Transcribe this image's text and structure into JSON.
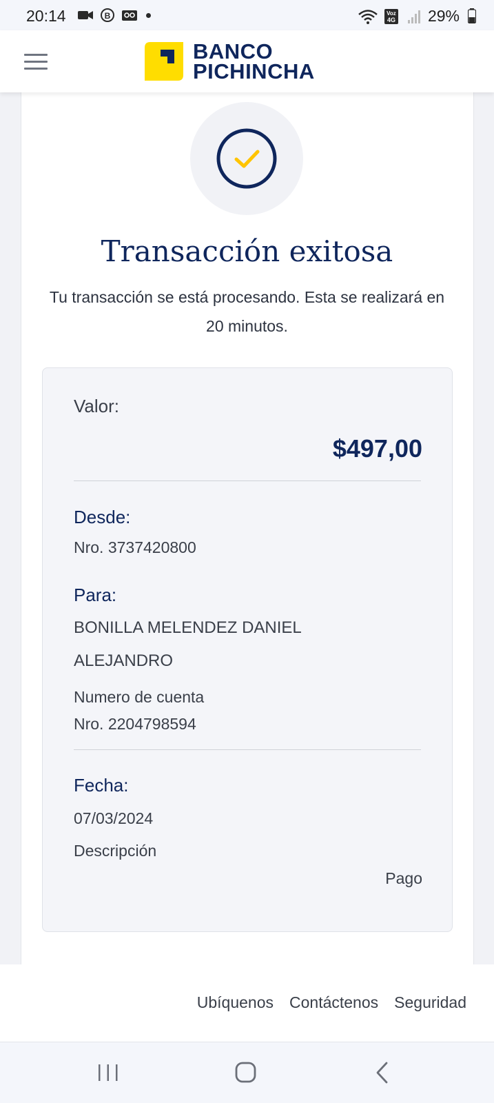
{
  "status_bar": {
    "time": "20:14",
    "battery": "29%",
    "network_badge": "Voz 4G",
    "icons_left": [
      "video-call-icon",
      "b-circle-icon",
      "voicemail-icon",
      "notification-dot-icon"
    ],
    "icons_right": [
      "wifi-icon",
      "volte-4g-icon",
      "signal-icon",
      "battery-icon"
    ]
  },
  "header": {
    "logo_line1": "BANCO",
    "logo_line2": "PICHINCHA",
    "menu_icon": "hamburger-menu-icon",
    "brand_yellow": "#FFDD00",
    "brand_navy": "#0F265C"
  },
  "result": {
    "icon": "check-circle-icon",
    "title": "Transacción exitosa",
    "subtitle": "Tu transacción se está procesando. Esta se realizará en 20 minutos."
  },
  "details": {
    "valor_label": "Valor:",
    "amount": "$497,00",
    "desde_label": "Desde:",
    "desde_value": "Nro. 3737420800",
    "para_label": "Para:",
    "para_name": "BONILLA MELENDEZ DANIEL ALEJANDRO",
    "para_account_label": "Numero de cuenta",
    "para_account": "Nro. 2204798594",
    "fecha_label": "Fecha:",
    "fecha_value": "07/03/2024",
    "descripcion_label": "Descripción",
    "descripcion_value": "Pago"
  },
  "footer": {
    "links": [
      "Ubíquenos",
      "Contáctenos",
      "Seguridad"
    ]
  },
  "nav": {
    "buttons": [
      "recent-apps-icon",
      "home-icon",
      "back-icon"
    ]
  }
}
